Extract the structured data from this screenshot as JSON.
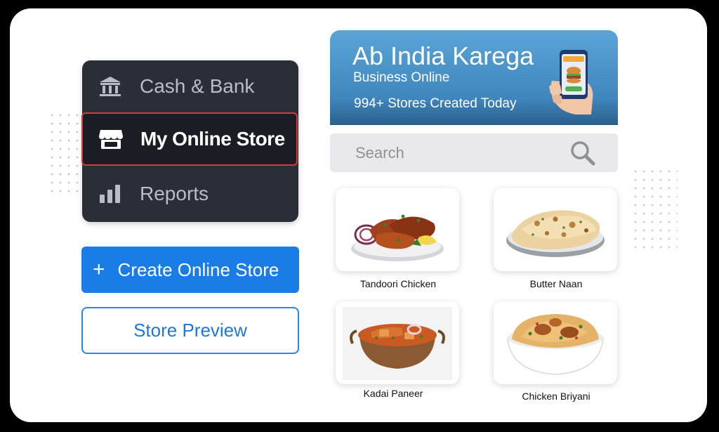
{
  "menu": {
    "items": [
      {
        "label": "Cash & Bank",
        "icon": "bank-icon"
      },
      {
        "label": "My Online Store",
        "icon": "store-icon",
        "selected": true
      },
      {
        "label": "Reports",
        "icon": "bar-chart-icon"
      }
    ]
  },
  "buttons": {
    "create_icon": "+",
    "create_label": "Create Online Store",
    "preview_label": "Store Preview"
  },
  "banner": {
    "title": "Ab India Karega",
    "subtitle": "Business Online",
    "stat": "994+ Stores Created Today"
  },
  "search": {
    "placeholder": "Search"
  },
  "products": [
    {
      "name": "Tandoori Chicken"
    },
    {
      "name": "Butter Naan"
    },
    {
      "name": "Kadai Paneer"
    },
    {
      "name": "Chicken Briyani"
    }
  ],
  "colors": {
    "menu_bg": "#2a2f37",
    "selected_border": "#d63a3a",
    "primary_blue": "#1a7de6",
    "banner_blue": "#4a93c9"
  }
}
